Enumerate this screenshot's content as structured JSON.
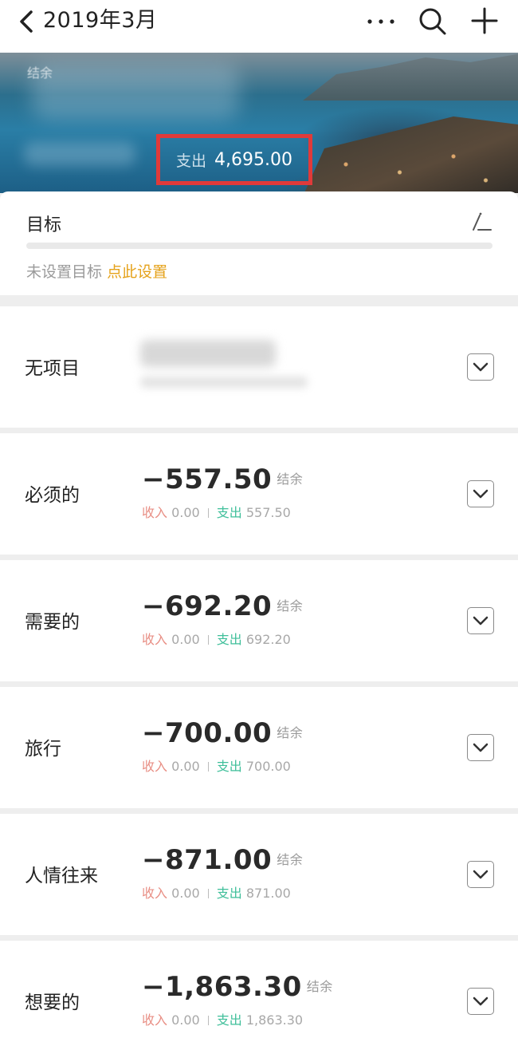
{
  "header": {
    "title": "2019年3月"
  },
  "hero": {
    "obscured_label": "结余",
    "expense_label": "支出",
    "expense_value": "4,695.00"
  },
  "goal": {
    "title": "目标",
    "hint_prefix": "未设置目标",
    "hint_link": "点此设置"
  },
  "projects": [
    {
      "name": "无项目",
      "amount": "",
      "balance_label": "",
      "income_label": "",
      "income": "",
      "expense_label": "",
      "expense": "",
      "obscured": true
    },
    {
      "name": "必须的",
      "amount": "−557.50",
      "balance_label": "结余",
      "income_label": "收入",
      "income": "0.00",
      "expense_label": "支出",
      "expense": "557.50"
    },
    {
      "name": "需要的",
      "amount": "−692.20",
      "balance_label": "结余",
      "income_label": "收入",
      "income": "0.00",
      "expense_label": "支出",
      "expense": "692.20"
    },
    {
      "name": "旅行",
      "amount": "−700.00",
      "balance_label": "结余",
      "income_label": "收入",
      "income": "0.00",
      "expense_label": "支出",
      "expense": "700.00"
    },
    {
      "name": "人情往来",
      "amount": "−871.00",
      "balance_label": "结余",
      "income_label": "收入",
      "income": "0.00",
      "expense_label": "支出",
      "expense": "871.00"
    },
    {
      "name": "想要的",
      "amount": "−1,863.30",
      "balance_label": "结余",
      "income_label": "收入",
      "income": "0.00",
      "expense_label": "支出",
      "expense": "1,863.30"
    }
  ],
  "colors": {
    "income": "#e88e84",
    "expense": "#3fbf9a",
    "link": "#e5a21a",
    "highlight_box": "#e03a3a"
  }
}
